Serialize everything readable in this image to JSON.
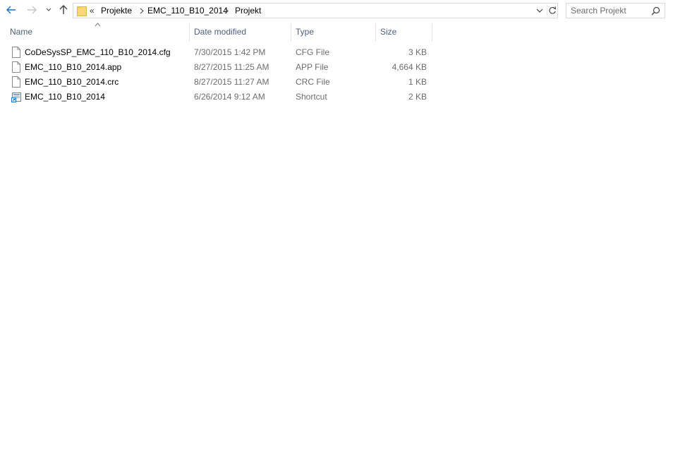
{
  "toolbar": {
    "back_icon": "arrow-left-icon",
    "forward_icon": "arrow-right-icon",
    "recent_icon": "chevron-down-icon",
    "up_icon": "arrow-up-icon"
  },
  "address": {
    "folder_icon": "folder-icon",
    "overflow": "«",
    "crumbs": [
      "Projekte",
      "EMC_110_B10_2014",
      "Projekt"
    ]
  },
  "search": {
    "placeholder": "Search Projekt"
  },
  "columns": {
    "name": "Name",
    "date": "Date modified",
    "type": "Type",
    "size": "Size"
  },
  "files": [
    {
      "name": "CoDeSysSP_EMC_110_B10_2014.cfg",
      "date": "7/30/2015 1:42 PM",
      "type": "CFG File",
      "size": "3 KB",
      "icon": "file-icon"
    },
    {
      "name": "EMC_110_B10_2014.app",
      "date": "8/27/2015 11:25 AM",
      "type": "APP File",
      "size": "4,664 KB",
      "icon": "file-icon"
    },
    {
      "name": "EMC_110_B10_2014.crc",
      "date": "8/27/2015 11:27 AM",
      "type": "CRC File",
      "size": "1 KB",
      "icon": "file-icon"
    },
    {
      "name": "EMC_110_B10_2014",
      "date": "6/26/2014 9:12 AM",
      "type": "Shortcut",
      "size": "2 KB",
      "icon": "shortcut-icon"
    }
  ],
  "colors": {
    "accent": "#1a73c8",
    "header_text": "#4c607a",
    "secondary_text": "#6d6d6d"
  }
}
